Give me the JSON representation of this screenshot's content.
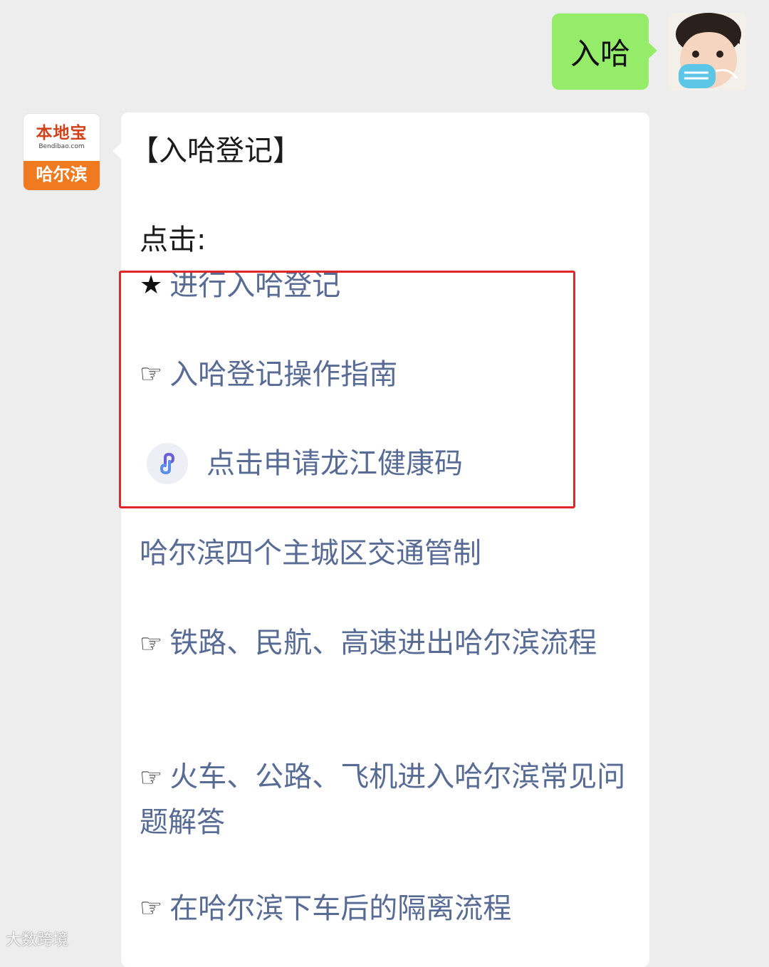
{
  "user_message": {
    "text": "入哈"
  },
  "bot_avatar": {
    "brand": "本地宝",
    "domain": "Bendibao.com",
    "city": "哈尔滨"
  },
  "card": {
    "title": "【入哈登记】",
    "click_label": "点击:",
    "highlighted_links": {
      "register": {
        "glyph": "★",
        "text": "进行入哈登记"
      },
      "guide": {
        "glyph": "☞",
        "text": "入哈登记操作指南"
      },
      "health_code": {
        "icon": "mini-program-link-icon",
        "text": "点击申请龙江健康码"
      }
    },
    "traffic_control": "哈尔滨四个主城区交通管制",
    "links": [
      {
        "glyph": "☞",
        "text": "铁路、民航、高速进出哈尔滨流程"
      },
      {
        "glyph": "☞",
        "text": "火车、公路、飞机进入哈尔滨常见问题解答"
      },
      {
        "glyph": "☞",
        "text": "在哈尔滨下车后的隔离流程"
      }
    ]
  },
  "watermark": "大数跨境",
  "colors": {
    "outgoing_bubble": "#95ec69",
    "link": "#576b95",
    "highlight_border": "#e0262b",
    "background": "#ededed"
  }
}
